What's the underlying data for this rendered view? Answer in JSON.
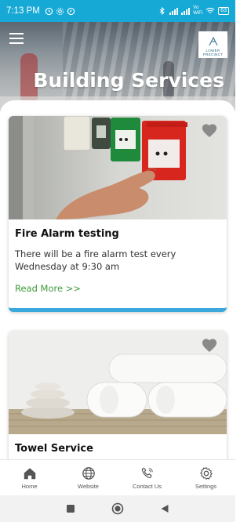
{
  "status_bar": {
    "time": "7:13 PM",
    "network_label": "Vo\nWiFi",
    "battery": "63"
  },
  "header": {
    "title": "Building Services",
    "logo_text": "LOWER PRECINCT",
    "menu_icon": "hamburger-menu-icon"
  },
  "cards": [
    {
      "title": "Fire Alarm testing",
      "text": "There will be a fire alarm test every Wednesday at 9:30 am",
      "link": "Read More >>",
      "favorite_icon": "heart-icon"
    },
    {
      "title": "Towel Service",
      "favorite_icon": "heart-icon"
    }
  ],
  "bottom_nav": {
    "items": [
      {
        "label": "Home",
        "icon": "home-icon"
      },
      {
        "label": "Website",
        "icon": "globe-icon"
      },
      {
        "label": "Contact Us",
        "icon": "phone-icon"
      },
      {
        "label": "Settings",
        "icon": "gear-icon"
      }
    ]
  },
  "system_nav": {
    "items": [
      "recent-apps-icon",
      "home-circle-icon",
      "back-icon"
    ]
  },
  "colors": {
    "status_bar": "#17a9d6",
    "accent_bar": "#3aa8dc",
    "link": "#3d9a3a"
  }
}
